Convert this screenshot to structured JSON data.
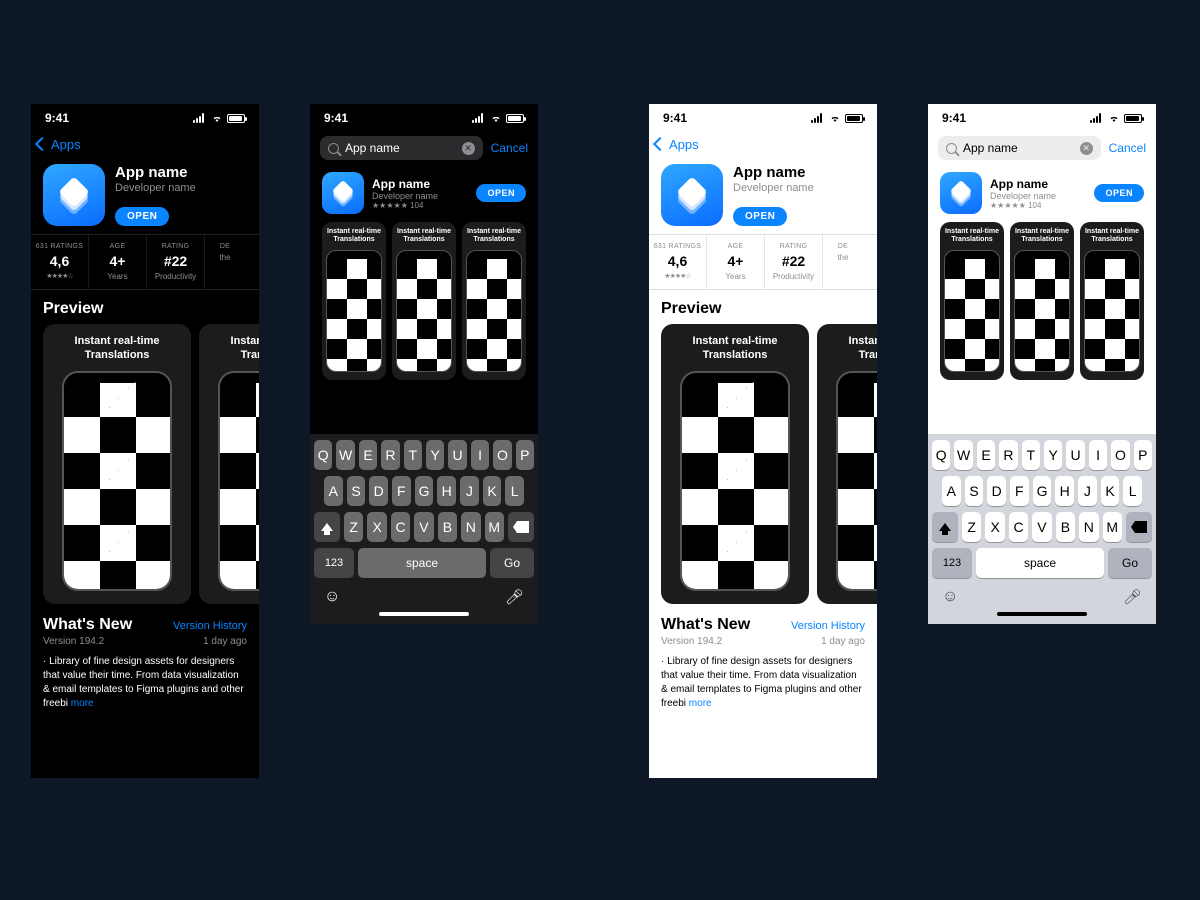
{
  "status": {
    "time": "9:41"
  },
  "colors": {
    "accent": "#0a84ff"
  },
  "detail": {
    "back_label": "Apps",
    "app_name": "App name",
    "developer": "Developer name",
    "open_label": "OPEN",
    "info": [
      {
        "label": "631 RATINGS",
        "value": "4,6",
        "sub": "★★★★☆"
      },
      {
        "label": "AGE",
        "value": "4+",
        "sub": "Years"
      },
      {
        "label": "RATING",
        "value": "#22",
        "sub": "Productivity"
      },
      {
        "label": "DE",
        "value": "",
        "sub": "the"
      }
    ],
    "preview_heading": "Preview",
    "preview_card_text": "Instant real-time Translations",
    "whats_new_heading": "What's New",
    "version_history": "Version History",
    "version": "Version 194.2",
    "updated": "1 day ago",
    "notes": "· Library of fine design assets for designers that value their time. From data visualization & email templates to Figma plugins and other freebi",
    "more": "more"
  },
  "search": {
    "query": "App name",
    "cancel": "Cancel",
    "result": {
      "name": "App name",
      "developer": "Developer name",
      "ratings_text": "★★★★★ 104",
      "open": "OPEN",
      "card_text": "Instant real-time Translations"
    }
  },
  "keyboard": {
    "row1": [
      "Q",
      "W",
      "E",
      "R",
      "T",
      "Y",
      "U",
      "I",
      "O",
      "P"
    ],
    "row2": [
      "A",
      "S",
      "D",
      "F",
      "G",
      "H",
      "J",
      "K",
      "L"
    ],
    "row3": [
      "Z",
      "X",
      "C",
      "V",
      "B",
      "N",
      "M"
    ],
    "numbers": "123",
    "space": "space",
    "go": "Go"
  }
}
